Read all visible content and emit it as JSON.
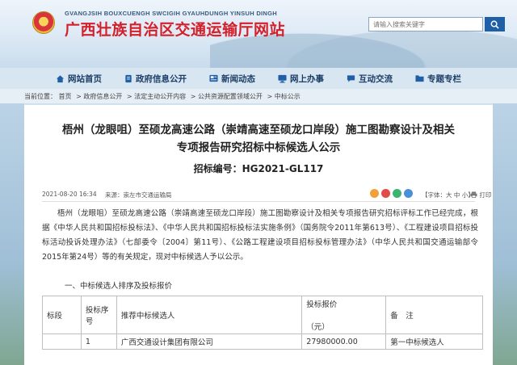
{
  "header": {
    "pinyin": "GVANGJSIH BOUXCUENGH SWCIGIH GYAUHDUNGH YINSUH DINGH",
    "title": "广西壮族自治区交通运输厅网站",
    "search_placeholder": "请输入搜索关键字"
  },
  "nav": {
    "items": [
      {
        "label": "网站首页",
        "icon": "home-icon"
      },
      {
        "label": "政府信息公开",
        "icon": "document-icon"
      },
      {
        "label": "新闻动态",
        "icon": "news-icon"
      },
      {
        "label": "网上办事",
        "icon": "monitor-icon"
      },
      {
        "label": "互动交流",
        "icon": "chat-icon"
      },
      {
        "label": "专题专栏",
        "icon": "folder-icon"
      }
    ]
  },
  "breadcrumb": {
    "prefix": "当前位置：",
    "items": [
      "首页",
      "政府信息公开",
      "法定主动公开内容",
      "公共资源配置领域公开",
      "中标公示"
    ],
    "separator": ">"
  },
  "article": {
    "title_line1": "梧州（龙眼咀）至硕龙高速公路（崇靖高速至硕龙口岸段）施工图勘察设计及相关",
    "title_line2": "专项报告研究招标中标候选人公示",
    "code": "招标编号：HG2021-GL117",
    "date": "2021-08-20 16:34",
    "source_label": "来源：",
    "source": "崇左市交通运输局",
    "font_label": "【字体：",
    "font_large": "大",
    "font_medium": "中",
    "font_small": "小",
    "font_close": "】",
    "print": "打印",
    "body": "梧州（龙眼咀）至硕龙高速公路（崇靖高速至硕龙口岸段）施工图勘察设计及相关专项报告研究招标评标工作已经完成，根据《中华人民共和国招标投标法》、《中华人民共和国招标投标法实施条例》（国务院令2011年第613号）、《工程建设项目招标投标活动投诉处理办法》（七部委令〔2004〕第11号）、《公路工程建设项目招标投标管理办法》（中华人民共和国交通运输部令2015年第24号）等的有关规定，现对中标候选人予以公示。",
    "section1": "一、中标候选人排序及投标报价"
  },
  "table": {
    "headers": {
      "c1": "标段",
      "c2_line1": "投标序",
      "c2_line2": "号",
      "c3": "推荐中标候选人",
      "c4_line1": "投标报价",
      "c4_line2": "（元）",
      "c5": "备　注"
    },
    "rows": [
      {
        "c1": "",
        "c2": "1",
        "c3": "广西交通设计集团有限公司",
        "c4": "27980000.00",
        "c5": "第一中标候选人"
      }
    ]
  },
  "colors": {
    "title_red": "#d4202a",
    "nav_text": "#1b3d66",
    "search_button": "#1e5fa8"
  }
}
